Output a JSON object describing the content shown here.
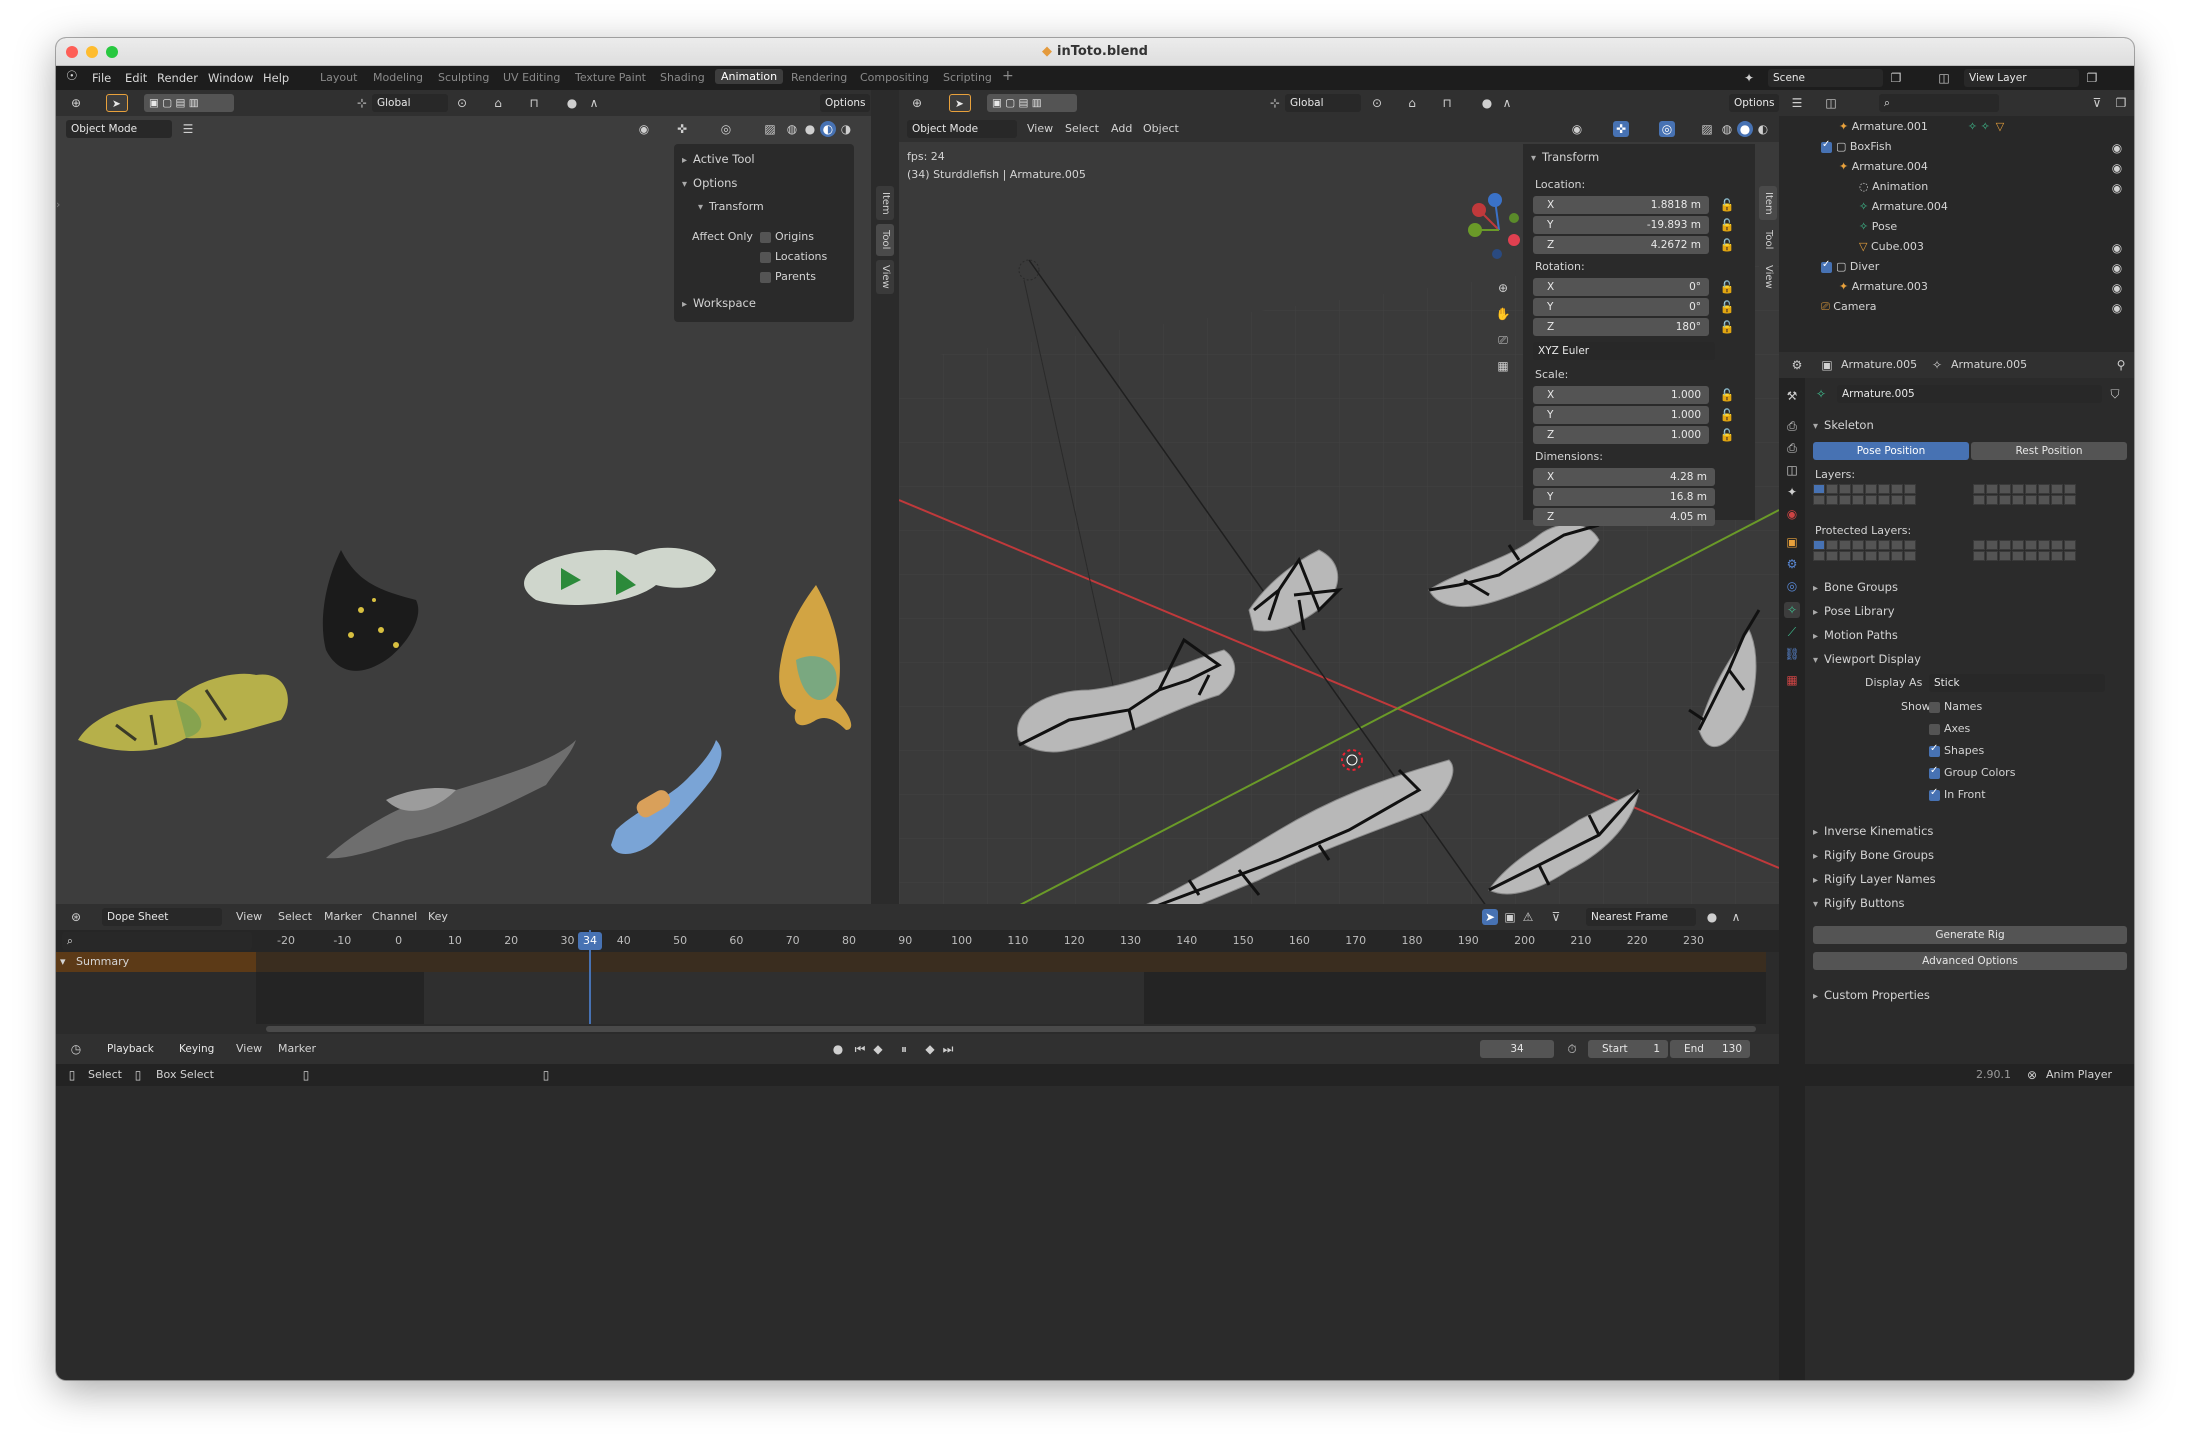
{
  "window": {
    "title": "inToto.blend"
  },
  "menu": {
    "items": [
      "File",
      "Edit",
      "Render",
      "Window",
      "Help"
    ],
    "workspaces": [
      "Layout",
      "Modeling",
      "Sculpting",
      "UV Editing",
      "Texture Paint",
      "Shading",
      "Animation",
      "Rendering",
      "Compositing",
      "Scripting"
    ],
    "active_workspace": "Animation",
    "add_workspace": "+",
    "scene": "Scene",
    "view_layer": "View Layer"
  },
  "left_view": {
    "orientation": "Global",
    "options_label": "Options",
    "mode": "Object Mode",
    "panel": {
      "active_tool": "Active Tool",
      "options": "Options",
      "transform": "Transform",
      "affect_only": "Affect Only",
      "origins": "Origins",
      "locations": "Locations",
      "parents": "Parents",
      "workspace": "Workspace"
    },
    "tabs": [
      "Item",
      "Tool",
      "View"
    ]
  },
  "main_view": {
    "orientation": "Global",
    "options_label": "Options",
    "mode": "Object Mode",
    "menus": [
      "View",
      "Select",
      "Add",
      "Object"
    ],
    "fps": "fps: 24",
    "info": "(34) Sturddlefish | Armature.005",
    "tabs": [
      "Item",
      "Tool",
      "View"
    ],
    "transform": {
      "title": "Transform",
      "location_label": "Location:",
      "location": [
        [
          "X",
          "1.8818 m"
        ],
        [
          "Y",
          "-19.893 m"
        ],
        [
          "Z",
          "4.2672 m"
        ]
      ],
      "rotation_label": "Rotation:",
      "rotation": [
        [
          "X",
          "0°"
        ],
        [
          "Y",
          "0°"
        ],
        [
          "Z",
          "180°"
        ]
      ],
      "euler": "XYZ Euler",
      "scale_label": "Scale:",
      "scale": [
        [
          "X",
          "1.000"
        ],
        [
          "Y",
          "1.000"
        ],
        [
          "Z",
          "1.000"
        ]
      ],
      "dimensions_label": "Dimensions:",
      "dimensions": [
        [
          "X",
          "4.28 m"
        ],
        [
          "Y",
          "16.8 m"
        ],
        [
          "Z",
          "4.05 m"
        ]
      ]
    }
  },
  "outliner": {
    "rows": [
      {
        "label": "Armature.001"
      },
      {
        "label": "BoxFish"
      },
      {
        "label": "Armature.004"
      },
      {
        "label": "Animation"
      },
      {
        "label": "Armature.004"
      },
      {
        "label": "Pose"
      },
      {
        "label": "Cube.003"
      },
      {
        "label": "Diver"
      },
      {
        "label": "Armature.003"
      },
      {
        "label": "Camera"
      }
    ]
  },
  "properties": {
    "crumb_object": "Armature.005",
    "crumb_data": "Armature.005",
    "datablock": "Armature.005",
    "skeleton": "Skeleton",
    "pose_position": "Pose Position",
    "rest_position": "Rest Position",
    "layers": "Layers:",
    "protected_layers": "Protected Layers:",
    "bone_groups": "Bone Groups",
    "pose_library": "Pose Library",
    "motion_paths": "Motion Paths",
    "viewport_display": "Viewport Display",
    "display_as_label": "Display As",
    "display_as": "Stick",
    "show_label": "Show",
    "show": [
      {
        "label": "Names",
        "checked": false
      },
      {
        "label": "Axes",
        "checked": false
      },
      {
        "label": "Shapes",
        "checked": true
      },
      {
        "label": "Group Colors",
        "checked": true
      },
      {
        "label": "In Front",
        "checked": true
      }
    ],
    "inverse_kinematics": "Inverse Kinematics",
    "rigify_bone_groups": "Rigify Bone Groups",
    "rigify_layer_names": "Rigify Layer Names",
    "rigify_buttons": "Rigify Buttons",
    "generate_rig": "Generate Rig",
    "advanced_options": "Advanced Options",
    "custom_properties": "Custom Properties"
  },
  "dopesheet": {
    "editor": "Dope Sheet",
    "menus": [
      "View",
      "Select",
      "Marker",
      "Channel",
      "Key"
    ],
    "snap": "Nearest Frame",
    "summary": "Summary",
    "ticks": [
      "-20",
      "-10",
      "0",
      "10",
      "20",
      "30",
      "40",
      "50",
      "60",
      "70",
      "80",
      "90",
      "100",
      "110",
      "120",
      "130",
      "140",
      "150",
      "160",
      "170",
      "180",
      "190",
      "200",
      "210",
      "220",
      "230"
    ],
    "current_frame": "34"
  },
  "timeline": {
    "menus": [
      "Playback",
      "Keying",
      "View",
      "Marker"
    ],
    "current_frame": "34",
    "start_label": "Start",
    "start": "1",
    "end_label": "End",
    "end": "130"
  },
  "status": {
    "select": "Select",
    "box_select": "Box Select",
    "version": "2.90.1",
    "anim_player": "Anim Player"
  },
  "colors": {
    "accent_blue": "#4772b3",
    "frame_indicator": "#4772b3",
    "x_axis": "#c0393b",
    "y_axis": "#6a9a28",
    "summary_row": "#5c3a17"
  }
}
